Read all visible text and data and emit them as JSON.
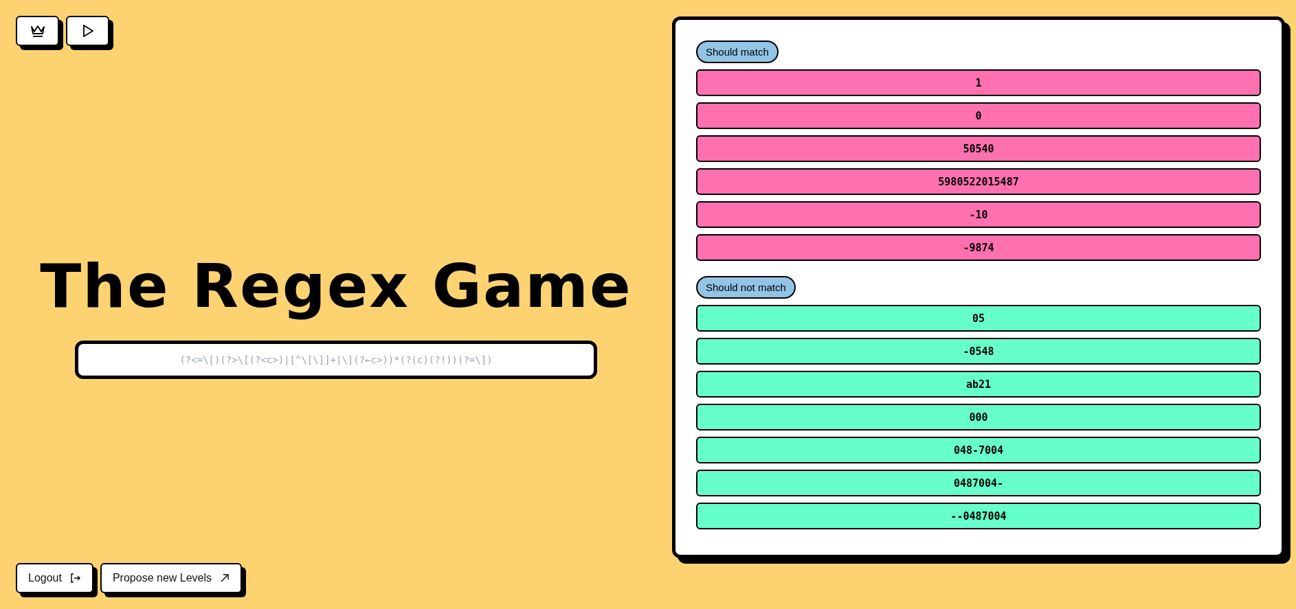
{
  "top_buttons": [
    {
      "kind": "crown"
    },
    {
      "kind": "play"
    }
  ],
  "title": "The Regex Game",
  "regex_input": {
    "placeholder": "(?<=\\[)(?>\\[(?<c>)|[^\\[\\]]+|\\](?←c>))*(?(c)(?!))(?=\\])"
  },
  "bottom_buttons": [
    {
      "label": "Logout",
      "kind": "logout"
    },
    {
      "label": "Propose new Levels",
      "kind": "external"
    }
  ],
  "groups": [
    {
      "label": "Should match",
      "kind": "match",
      "items": [
        "1",
        "0",
        "50540",
        "5980522015487",
        "-10",
        "-9874"
      ]
    },
    {
      "label": "Should not match",
      "kind": "nomatch",
      "items": [
        "05",
        "-0548",
        "ab21",
        "000",
        "048-7004",
        "0487004-",
        "--0487004"
      ]
    }
  ]
}
